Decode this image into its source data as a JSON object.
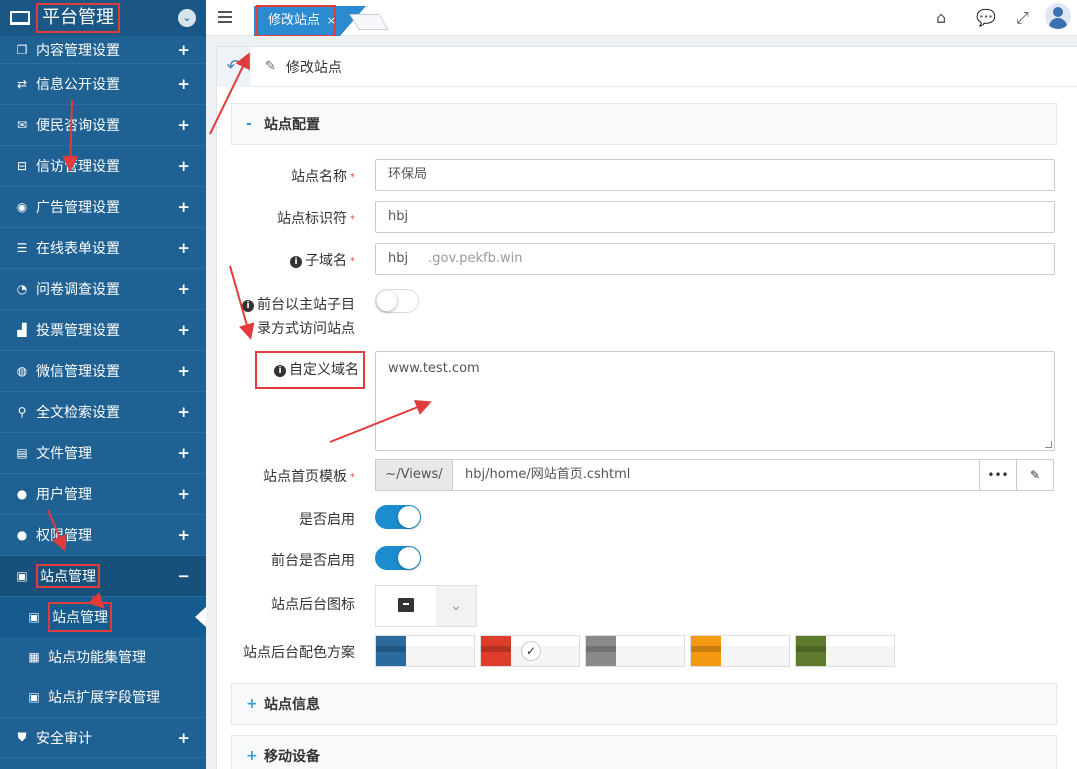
{
  "sidebar": {
    "title": "平台管理",
    "toggle_icon": "chevron-down-icon",
    "items": [
      {
        "label": "内容管理设置",
        "icon": "copy-icon"
      },
      {
        "label": "信息公开设置",
        "icon": "exchange-icon"
      },
      {
        "label": "便民咨询设置",
        "icon": "envelope-icon"
      },
      {
        "label": "信访管理设置",
        "icon": "inbox-icon"
      },
      {
        "label": "广告管理设置",
        "icon": "ad-icon"
      },
      {
        "label": "在线表单设置",
        "icon": "file-text-icon"
      },
      {
        "label": "问卷调查设置",
        "icon": "pie-chart-icon"
      },
      {
        "label": "投票管理设置",
        "icon": "bar-chart-icon"
      },
      {
        "label": "微信管理设置",
        "icon": "wechat-icon"
      },
      {
        "label": "全文检索设置",
        "icon": "search-icon"
      },
      {
        "label": "文件管理",
        "icon": "file-icon"
      },
      {
        "label": "用户管理",
        "icon": "user-icon"
      },
      {
        "label": "权限管理",
        "icon": "user-lock-icon"
      },
      {
        "label": "站点管理",
        "icon": "site-icon"
      }
    ],
    "subitems": [
      {
        "label": "站点管理",
        "icon": "site-icon"
      },
      {
        "label": "站点功能集管理",
        "icon": "grid-icon"
      },
      {
        "label": "站点扩展字段管理",
        "icon": "site-icon"
      }
    ],
    "last_item": {
      "label": "安全审计",
      "icon": "shield-icon"
    },
    "plus": "+",
    "minus": "−"
  },
  "topbar": {
    "tab_label": "修改站点",
    "tab_close": "×"
  },
  "page": {
    "title": "修改站点"
  },
  "sections": {
    "config": {
      "title": "站点配置",
      "sign": "-"
    },
    "info": {
      "title": "站点信息",
      "sign": "+"
    },
    "mobile": {
      "title": "移动设备",
      "sign": "+"
    }
  },
  "form": {
    "site_name": {
      "label": "站点名称",
      "value": "环保局",
      "required": "*"
    },
    "site_id": {
      "label": "站点标识符",
      "value": "hbj",
      "required": "*"
    },
    "subdomain": {
      "label": "子域名",
      "value": "hbj",
      "suffix": ".gov.pekfb.win",
      "required": "*"
    },
    "dir_access": {
      "label_line1": "前台以主站子目",
      "label_line2": "录方式访问站点",
      "enabled": false
    },
    "custom_domain": {
      "label": "自定义域名",
      "value": "www.test.com"
    },
    "template": {
      "label": "站点首页模板",
      "prefix": "~/Views/",
      "value": "hbj/home/网站首页.cshtml",
      "required": "*",
      "browse": "•••",
      "edit_icon": "edit-icon"
    },
    "enabled": {
      "label": "是否启用",
      "enabled": true
    },
    "front_enabled": {
      "label": "前台是否启用",
      "enabled": true
    },
    "admin_icon": {
      "label": "站点后台图标",
      "icon": "archive-icon"
    },
    "color_scheme": {
      "label": "站点后台配色方案",
      "options": [
        {
          "color": "#2a6a9c",
          "selected": false
        },
        {
          "color": "#dd3d2a",
          "selected": true
        },
        {
          "color": "#8a8a8a",
          "selected": false
        },
        {
          "color": "#f39a12",
          "selected": false
        },
        {
          "color": "#5e7a2c",
          "selected": false
        }
      ],
      "check": "✓"
    }
  },
  "colors": {
    "sidebar": "#1f6192",
    "accent": "#2b8ad0",
    "toggle_on": "#1b8ccd",
    "annotation": "#e23b3b"
  }
}
